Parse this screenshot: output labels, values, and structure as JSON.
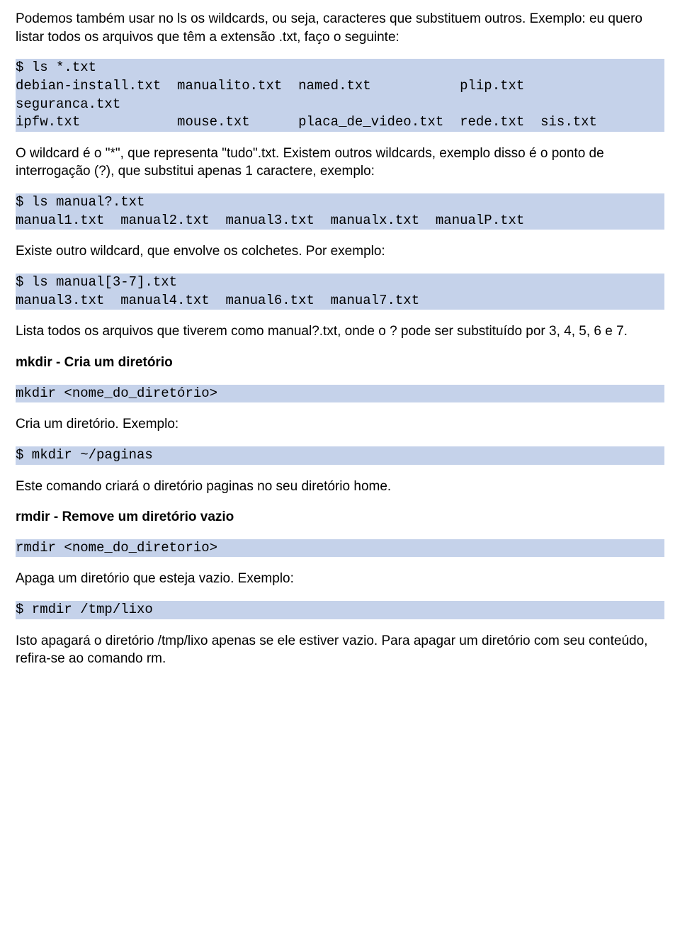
{
  "p1": "Podemos também usar no ls os wildcards, ou seja, caracteres que substituem outros. Exemplo: eu quero listar todos os arquivos que têm a extensão .txt, faço o seguinte:",
  "code1": "$ ls *.txt\ndebian-install.txt  manualito.txt  named.txt           plip.txt\nseguranca.txt\nipfw.txt            mouse.txt      placa_de_video.txt  rede.txt  sis.txt",
  "p2": "O wildcard é o \"*\", que representa \"tudo\".txt. Existem outros wildcards, exemplo disso é o ponto de interrogação (?), que substitui apenas 1 caractere, exemplo:",
  "code2": "$ ls manual?.txt\nmanual1.txt  manual2.txt  manual3.txt  manualx.txt  manualP.txt",
  "p3": "Existe outro wildcard, que envolve os colchetes. Por exemplo:",
  "code3": "$ ls manual[3-7].txt\nmanual3.txt  manual4.txt  manual6.txt  manual7.txt",
  "p4": "Lista todos os arquivos que tiverem como manual?.txt, onde o ? pode ser substituído por 3, 4, 5, 6 e 7.",
  "h1": "mkdir - Cria um diretório",
  "code4": "mkdir <nome_do_diretório>",
  "p5": "Cria um diretório. Exemplo:",
  "code5": "$ mkdir ~/paginas",
  "p6": "Este comando criará o diretório paginas no seu diretório home.",
  "h2": "rmdir - Remove um diretório vazio",
  "code6": "rmdir <nome_do_diretorio>",
  "p7": "Apaga um diretório que esteja vazio. Exemplo:",
  "code7": "$ rmdir /tmp/lixo",
  "p8": "Isto apagará o diretório /tmp/lixo apenas se ele estiver vazio. Para apagar um diretório com seu conteúdo, refira-se ao comando rm."
}
